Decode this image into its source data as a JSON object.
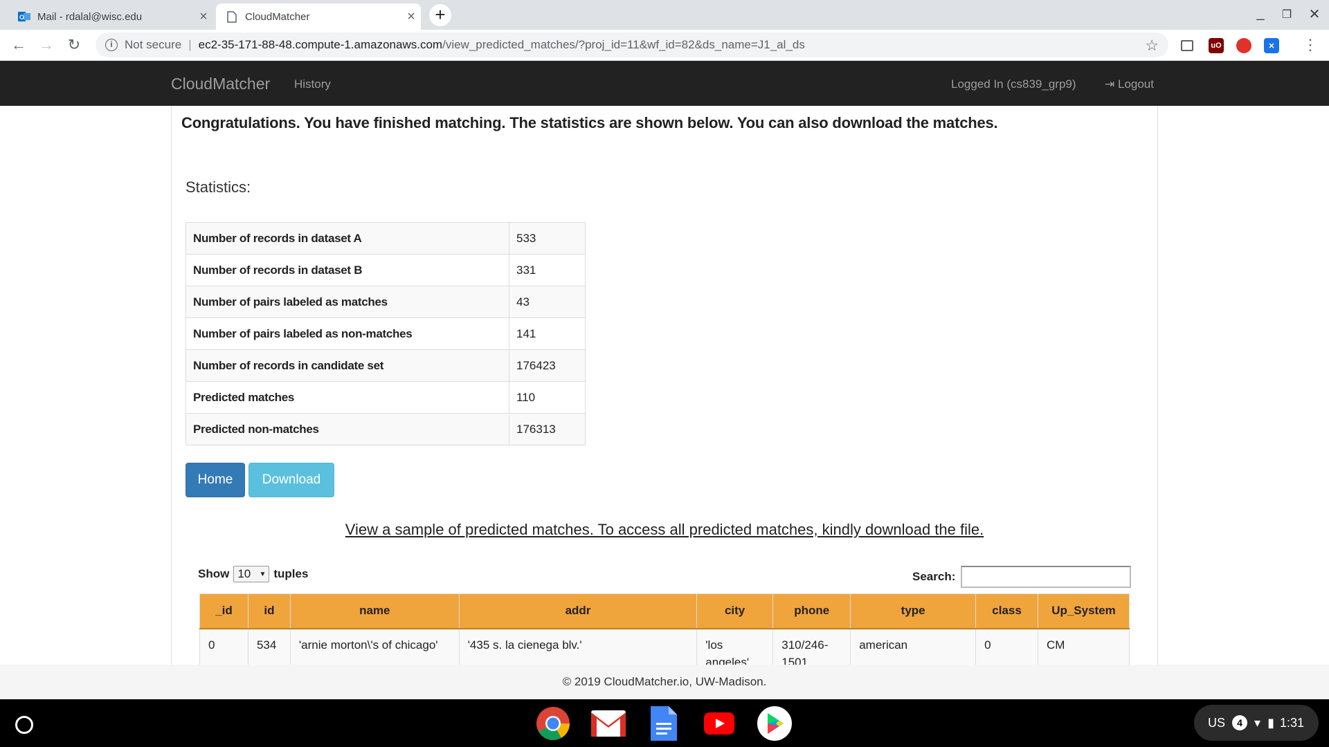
{
  "browser": {
    "tabs": [
      {
        "label": "Mail - rdalal@wisc.edu"
      },
      {
        "label": "CloudMatcher"
      }
    ],
    "security_label": "Not secure",
    "url_host": "ec2-35-171-88-48.compute-1.amazonaws.com",
    "url_path": "/view_predicted_matches/?proj_id=11&wf_id=82&ds_name=J1_al_ds"
  },
  "nav": {
    "brand": "CloudMatcher",
    "history": "History",
    "logged_in": "Logged In (cs839_grp9)",
    "logout": "Logout"
  },
  "main": {
    "congrats": "Congratulations. You have finished matching. The statistics are shown below. You can also download the matches.",
    "stats_title": "Statistics:",
    "stats": [
      {
        "label": "Number of records in dataset A",
        "value": "533"
      },
      {
        "label": "Number of records in dataset B",
        "value": "331"
      },
      {
        "label": "Number of pairs labeled as matches",
        "value": "43"
      },
      {
        "label": "Number of pairs labeled as non-matches",
        "value": "141"
      },
      {
        "label": "Number of records in candidate set",
        "value": "176423"
      },
      {
        "label": "Predicted matches",
        "value": "110"
      },
      {
        "label": "Predicted non-matches",
        "value": "176313"
      }
    ],
    "home_label": "Home",
    "download_label": "Download",
    "sample_link": "View a sample of predicted matches. To access all predicted matches, kindly download the file.",
    "show_label": "Show",
    "show_value": "10",
    "tuples_label": "tuples",
    "search_label": "Search:",
    "columns": [
      "_id",
      "id",
      "name",
      "addr",
      "city",
      "phone",
      "type",
      "class",
      "Up_System"
    ],
    "rows": [
      [
        "0",
        "534",
        "'arnie morton\\'s of chicago'",
        "'435 s. la cienega blv.'",
        "'los angeles'",
        "310/246-1501",
        "american",
        "0",
        "CM"
      ]
    ]
  },
  "footer": {
    "text": "© 2019 CloudMatcher.io, UW-Madison."
  },
  "shelf": {
    "locale": "US",
    "notifications": "4",
    "time": "1:31"
  },
  "colors": {
    "primary": "#337ab7",
    "info": "#5bc0de",
    "table_header": "#f0a43c",
    "navbar": "#222222"
  }
}
